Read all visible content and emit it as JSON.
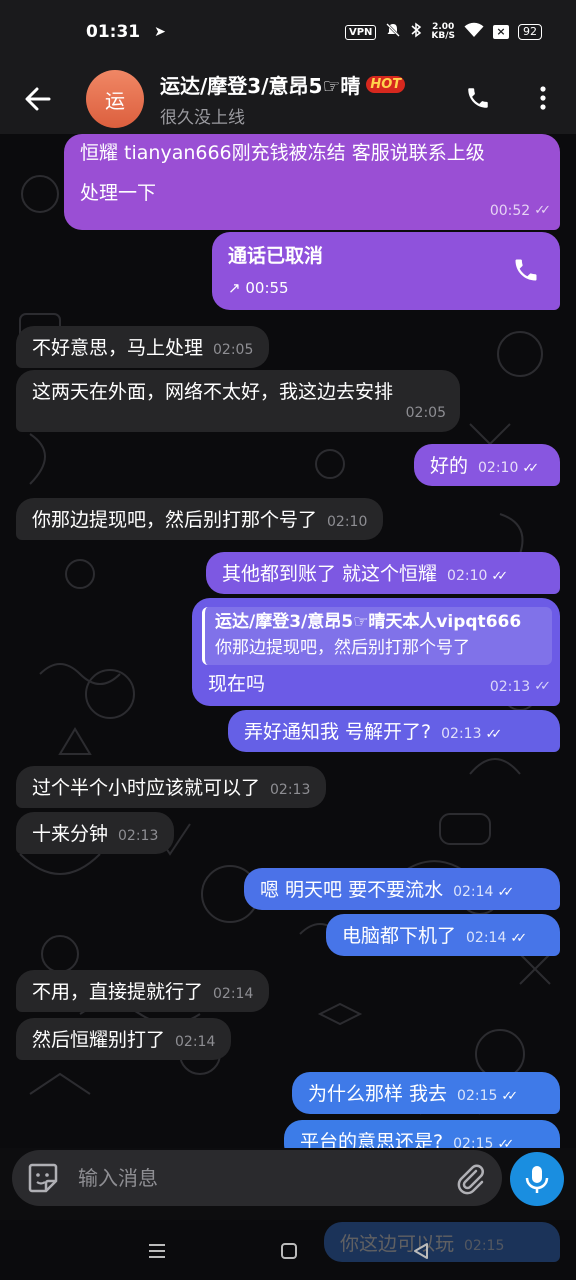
{
  "status_bar": {
    "time": "01:31",
    "vpn": "VPN",
    "speed_value": "2.00",
    "speed_unit": "KB/S",
    "sim_label": "×",
    "battery": "92"
  },
  "header": {
    "avatar_text": "运",
    "title": "运达/摩登3/意昂5☞晴",
    "hot_badge": "HOT",
    "subtitle": "很久没上线"
  },
  "messages": [
    {
      "dir": "out",
      "text1": "恒耀  tianyan666刚充钱被冻结  客服说联系上级",
      "text2": "处理一下",
      "time": "00:52"
    },
    {
      "dir": "out",
      "kind": "call",
      "text": "通话已取消",
      "time": "00:55"
    },
    {
      "dir": "in",
      "text": "不好意思，马上处理",
      "time": "02:05"
    },
    {
      "dir": "in",
      "text": "这两天在外面，网络不太好，我这边去安排",
      "time": "02:05"
    },
    {
      "dir": "out",
      "text": "好的",
      "time": "02:10"
    },
    {
      "dir": "in",
      "text": "你那边提现吧，然后别打那个号了",
      "time": "02:10"
    },
    {
      "dir": "out",
      "text": "其他都到账了  就这个恒耀",
      "time": "02:10"
    },
    {
      "dir": "out",
      "reply_name": "运达/摩登3/意昂5☞晴天本人vipqt666",
      "reply_text": "你那边提现吧，然后别打那个号了",
      "text": "现在吗",
      "time": "02:13"
    },
    {
      "dir": "out",
      "text": "弄好通知我  号解开了?",
      "time": "02:13"
    },
    {
      "dir": "in",
      "text": "过个半个小时应该就可以了",
      "time": "02:13"
    },
    {
      "dir": "in",
      "text": "十来分钟",
      "time": "02:13"
    },
    {
      "dir": "out",
      "text": "嗯  明天吧 要不要流水",
      "time": "02:14"
    },
    {
      "dir": "out",
      "text": "电脑都下机了",
      "time": "02:14"
    },
    {
      "dir": "in",
      "text": "不用，直接提就行了",
      "time": "02:14"
    },
    {
      "dir": "in",
      "text": "然后恒耀别打了",
      "time": "02:14"
    },
    {
      "dir": "out",
      "text": "为什么那样  我去",
      "time": "02:15"
    },
    {
      "dir": "out",
      "text": "平台的意思还是?",
      "time": "02:15"
    },
    {
      "dir": "out",
      "text": "你这边可以玩",
      "time": "02:15"
    }
  ],
  "input": {
    "placeholder": "输入消息"
  },
  "icons": {
    "back": "arrow-left-icon",
    "call": "phone-icon",
    "menu": "more-vertical-icon",
    "emoji": "sticker-icon",
    "attach": "paperclip-icon",
    "mic": "microphone-icon"
  },
  "colors": {
    "bubble_purple": "#9a4fd4",
    "bubble_violet": "#6d5ce6",
    "bubble_blue": "#3f78e8",
    "bubble_in": "#262628",
    "accent_blue": "#1a8ee0"
  }
}
